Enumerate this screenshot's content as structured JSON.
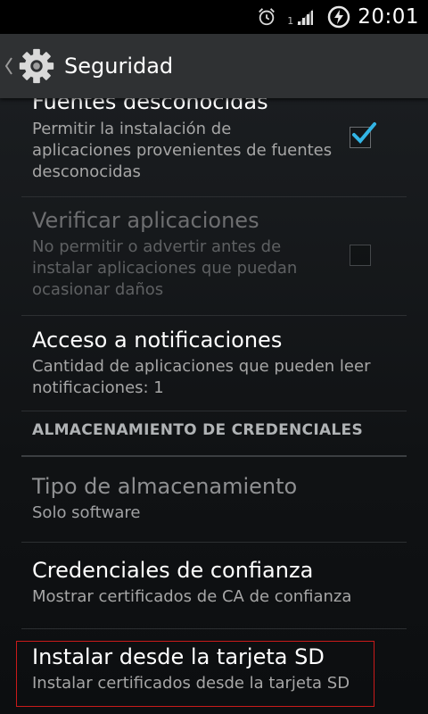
{
  "status_bar": {
    "time": "20:01",
    "sim_slot": "1",
    "icons": [
      "alarm-icon",
      "signal-icon",
      "battery-charging-icon"
    ]
  },
  "action_bar": {
    "title": "Seguridad",
    "icon": "gear-icon",
    "back": "chevron-left-icon"
  },
  "prefs": {
    "unknown_sources": {
      "title": "Fuentes desconocidas",
      "summary": "Permitir la instalación de aplicaciones provenientes de fuentes desconocidas",
      "checked": true
    },
    "verify_apps": {
      "title": "Verificar aplicaciones",
      "summary": "No permitir o advertir antes de instalar aplicaciones que puedan ocasionar daños",
      "checked": false,
      "enabled": false
    },
    "notification_access": {
      "title": "Acceso a notificaciones",
      "summary": "Cantidad de aplicaciones que pueden leer notificaciones: 1"
    },
    "credential_storage_header": "ALMACENAMIENTO DE CREDENCIALES",
    "storage_type": {
      "title": "Tipo de almacenamiento",
      "summary": "Solo software",
      "enabled": false
    },
    "trusted_credentials": {
      "title": "Credenciales de confianza",
      "summary": "Mostrar certificados de CA de confianza"
    },
    "install_from_sd": {
      "title": "Instalar desde la tarjeta SD",
      "summary": "Instalar certificados desde la tarjeta SD"
    }
  },
  "colors": {
    "accent": "#33b5e5",
    "highlight_border": "#c91a1a"
  }
}
